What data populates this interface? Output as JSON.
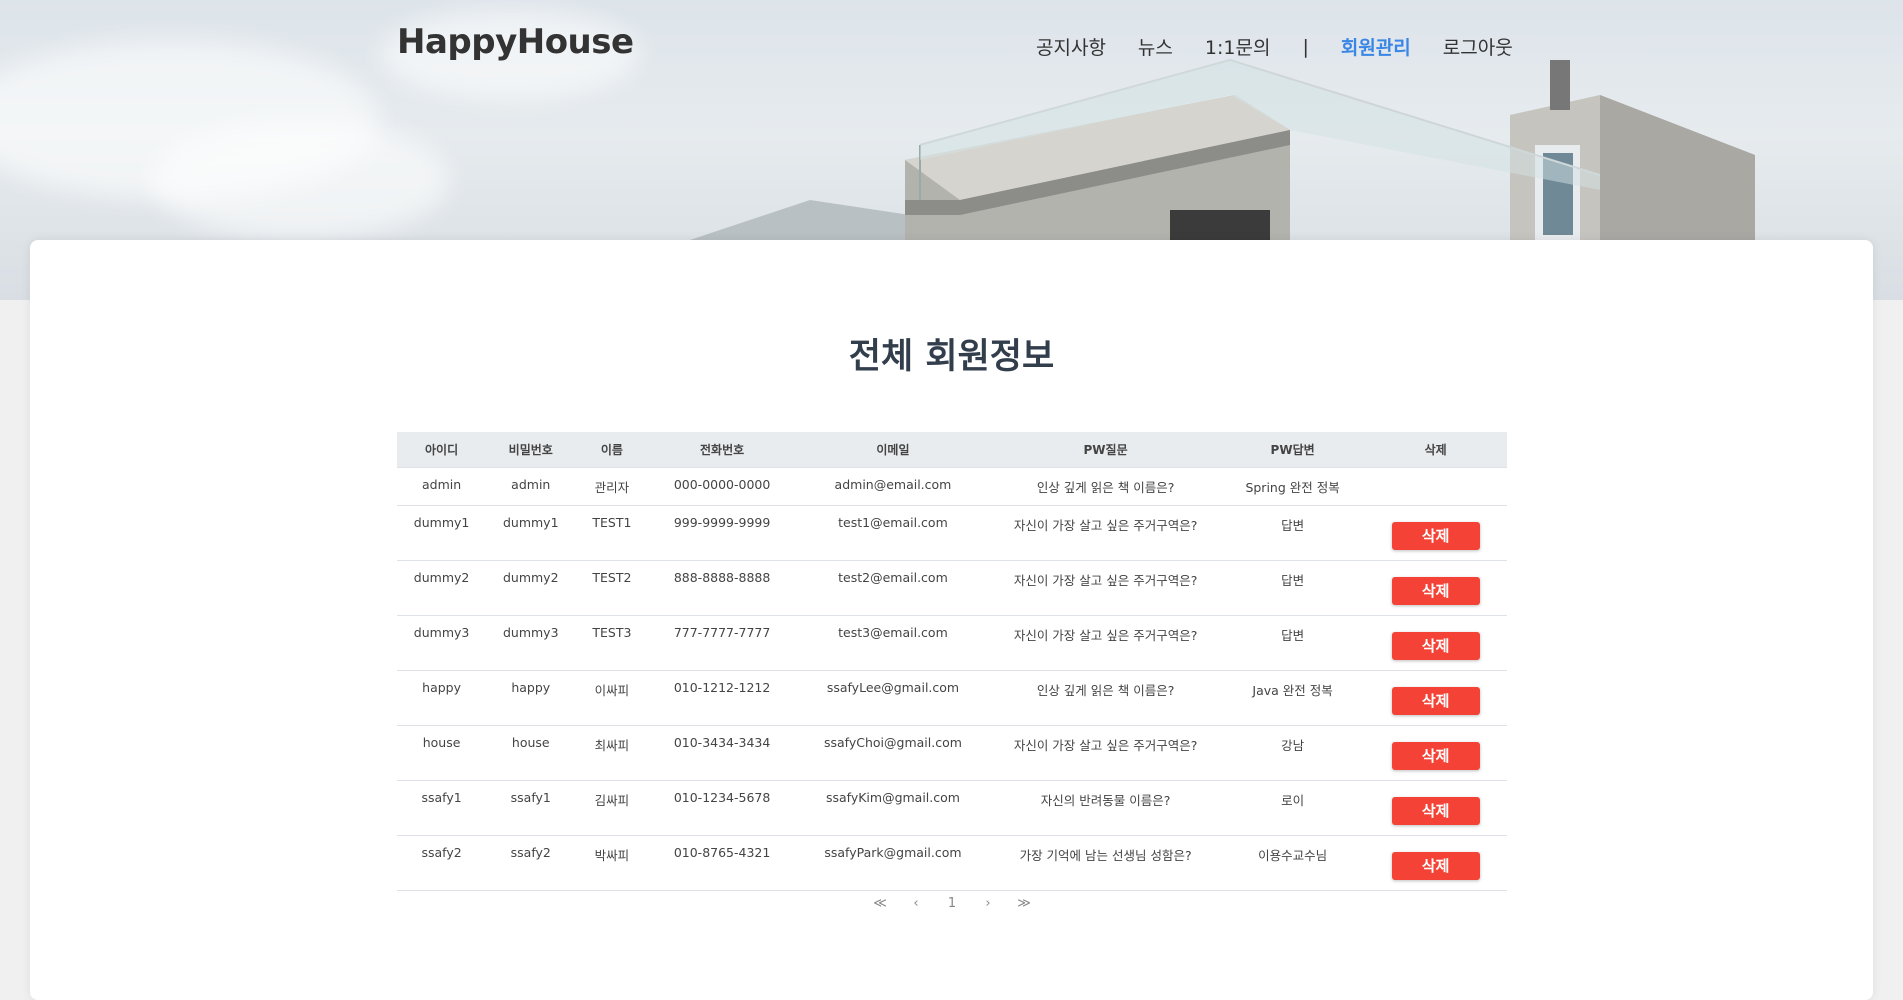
{
  "header": {
    "logo": "HappyHouse",
    "nav": [
      "공지사항",
      "뉴스",
      "1:1문의"
    ],
    "separator": "|",
    "active": "회원관리",
    "logout": "로그아웃"
  },
  "page_title": "전체 회원정보",
  "table": {
    "headers": [
      "아이디",
      "비밀번호",
      "이름",
      "전화번호",
      "이메일",
      "PW질문",
      "PW답변",
      "삭제"
    ],
    "rows": [
      {
        "id": "admin",
        "pw": "admin",
        "name": "관리자",
        "phone": "000-0000-0000",
        "email": "admin@email.com",
        "q": "인상 깊게 읽은 책 이름은?",
        "a": "Spring 완전 정복",
        "del": ""
      },
      {
        "id": "dummy1",
        "pw": "dummy1",
        "name": "TEST1",
        "phone": "999-9999-9999",
        "email": "test1@email.com",
        "q": "자신이 가장 살고 싶은 주거구역은?",
        "a": "답변",
        "del": "삭제"
      },
      {
        "id": "dummy2",
        "pw": "dummy2",
        "name": "TEST2",
        "phone": "888-8888-8888",
        "email": "test2@email.com",
        "q": "자신이 가장 살고 싶은 주거구역은?",
        "a": "답변",
        "del": "삭제"
      },
      {
        "id": "dummy3",
        "pw": "dummy3",
        "name": "TEST3",
        "phone": "777-7777-7777",
        "email": "test3@email.com",
        "q": "자신이 가장 살고 싶은 주거구역은?",
        "a": "답변",
        "del": "삭제"
      },
      {
        "id": "happy",
        "pw": "happy",
        "name": "이싸피",
        "phone": "010-1212-1212",
        "email": "ssafyLee@gmail.com",
        "q": "인상 깊게 읽은 책 이름은?",
        "a": "Java 완전 정복",
        "del": "삭제"
      },
      {
        "id": "house",
        "pw": "house",
        "name": "최싸피",
        "phone": "010-3434-3434",
        "email": "ssafyChoi@gmail.com",
        "q": "자신이 가장 살고 싶은 주거구역은?",
        "a": "강남",
        "del": "삭제"
      },
      {
        "id": "ssafy1",
        "pw": "ssafy1",
        "name": "김싸피",
        "phone": "010-1234-5678",
        "email": "ssafyKim@gmail.com",
        "q": "자신의 반려동물 이름은?",
        "a": "로이",
        "del": "삭제"
      },
      {
        "id": "ssafy2",
        "pw": "ssafy2",
        "name": "박싸피",
        "phone": "010-8765-4321",
        "email": "ssafyPark@gmail.com",
        "q": "가장 기억에 남는 선생님 성함은?",
        "a": "이용수교수님",
        "del": "삭제"
      }
    ]
  },
  "pagination": [
    "≪",
    "‹",
    "1",
    "›",
    "≫"
  ],
  "colors": {
    "accent": "#3a86e6",
    "delete": "#f44336",
    "title": "#333e4c"
  }
}
